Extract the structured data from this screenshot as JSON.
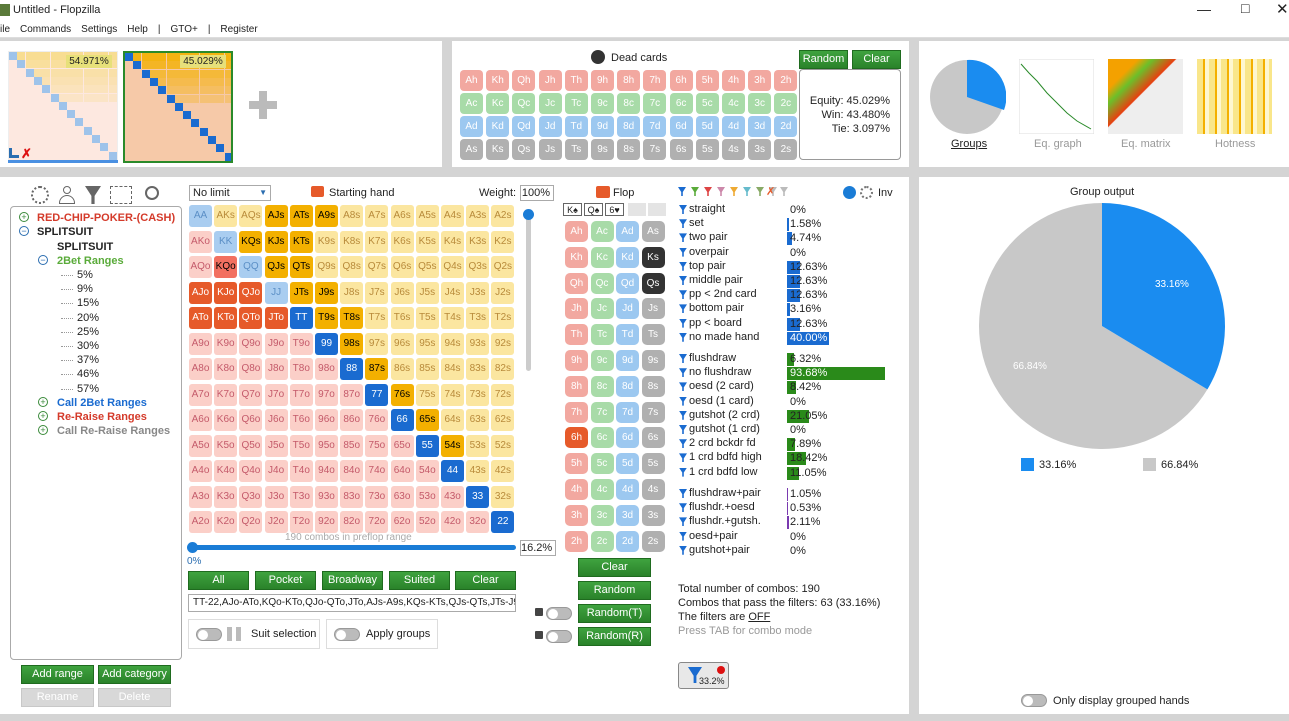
{
  "window": {
    "title": "Untitled - Flopzilla"
  },
  "menu": [
    "ile",
    "Commands",
    "Settings",
    "Help",
    "|",
    "GTO+",
    "|",
    "Register"
  ],
  "ranges_panel": {
    "range1_pct": "54.971%",
    "range2_pct": "45.029%"
  },
  "dead_cards": {
    "title": "Dead cards",
    "random_label": "Random",
    "clear_label": "Clear",
    "rows": [
      [
        "Ah",
        "Kh",
        "Qh",
        "Jh",
        "Th",
        "9h",
        "8h",
        "7h",
        "6h",
        "5h",
        "4h",
        "3h",
        "2h"
      ],
      [
        "Ac",
        "Kc",
        "Qc",
        "Jc",
        "Tc",
        "9c",
        "8c",
        "7c",
        "6c",
        "5c",
        "4c",
        "3c",
        "2c"
      ],
      [
        "Ad",
        "Kd",
        "Qd",
        "Jd",
        "Td",
        "9d",
        "8d",
        "7d",
        "6d",
        "5d",
        "4d",
        "3d",
        "2d"
      ],
      [
        "As",
        "Ks",
        "Qs",
        "Js",
        "Ts",
        "9s",
        "8s",
        "7s",
        "6s",
        "5s",
        "4s",
        "3s",
        "2s"
      ]
    ],
    "equity": "Equity: 45.029%",
    "win": "Win: 43.480%",
    "tie": "Tie: 3.097%"
  },
  "views": {
    "groups": "Groups",
    "eq_graph": "Eq. graph",
    "eq_matrix": "Eq. matrix",
    "hotness": "Hotness"
  },
  "tree": {
    "root1": "RED-CHIP-POKER-(CASH)",
    "root2": "SPLITSUIT",
    "child1": "SPLITSUIT",
    "group": "2Bet Ranges",
    "items": [
      "5%",
      "9%",
      "15%",
      "20%",
      "25%",
      "30%",
      "37%",
      "46%",
      "57%"
    ],
    "call2bet": "Call 2Bet Ranges",
    "reraise": "Re-Raise Ranges",
    "callreraise": "Call Re-Raise Ranges"
  },
  "tree_buttons": {
    "add_range": "Add range",
    "add_category": "Add category",
    "rename": "Rename",
    "delete": "Delete"
  },
  "grid": {
    "limit": "No limit",
    "starting_hand": "Starting hand",
    "weight_label": "Weight:",
    "weight_value": "100%",
    "combos_text": "190 combos in preflop range",
    "slider_min": "0%",
    "slider_value": "16.2%",
    "buttons": [
      "All",
      "Pocket",
      "Broadway",
      "Suited",
      "Clear"
    ],
    "range_text": "TT-22,AJo-ATo,KQo-KTo,QJo-QTo,JTo,AJs-A9s,KQs-KTs,QJs-QTs,JTs-J9s,",
    "suit_selection": "Suit selection",
    "apply_groups": "Apply groups"
  },
  "flop": {
    "title": "Flop",
    "board": [
      "K♠",
      "Q♠",
      "6♥"
    ],
    "clear_label": "Clear",
    "random_label": "Random",
    "random_t": "Random(T)",
    "random_r": "Random(R)"
  },
  "stats": {
    "inv": "Inv",
    "group1": [
      {
        "name": "straight",
        "val": "0%",
        "pct": 0
      },
      {
        "name": "set",
        "val": "1.58%",
        "pct": 1.58
      },
      {
        "name": "two pair",
        "val": "4.74%",
        "pct": 4.74
      },
      {
        "name": "overpair",
        "val": "0%",
        "pct": 0
      },
      {
        "name": "top pair",
        "val": "12.63%",
        "pct": 12.63
      },
      {
        "name": "middle pair",
        "val": "12.63%",
        "pct": 12.63
      },
      {
        "name": "pp < 2nd card",
        "val": "12.63%",
        "pct": 12.63
      },
      {
        "name": "bottom pair",
        "val": "3.16%",
        "pct": 3.16
      },
      {
        "name": "pp < board",
        "val": "12.63%",
        "pct": 12.63
      },
      {
        "name": "no made hand",
        "val": "40.00%",
        "pct": 40.0
      }
    ],
    "group2": [
      {
        "name": "flushdraw",
        "val": "6.32%",
        "pct": 6.32
      },
      {
        "name": "no flushdraw",
        "val": "93.68%",
        "pct": 93.68
      },
      {
        "name": "oesd (2 card)",
        "val": "8.42%",
        "pct": 8.42
      },
      {
        "name": "oesd (1 card)",
        "val": "0%",
        "pct": 0
      },
      {
        "name": "gutshot (2 crd)",
        "val": "21.05%",
        "pct": 21.05
      },
      {
        "name": "gutshot (1 crd)",
        "val": "0%",
        "pct": 0
      },
      {
        "name": "2 crd bckdr fd",
        "val": "7.89%",
        "pct": 7.89
      },
      {
        "name": "1 crd bdfd high",
        "val": "18.42%",
        "pct": 18.42
      },
      {
        "name": "1 crd bdfd low",
        "val": "11.05%",
        "pct": 11.05
      }
    ],
    "group3": [
      {
        "name": "flushdraw+pair",
        "val": "1.05%",
        "pct": 1.05
      },
      {
        "name": "flushdr.+oesd",
        "val": "0.53%",
        "pct": 0.53
      },
      {
        "name": "flushdr.+gutsh.",
        "val": "2.11%",
        "pct": 2.11
      },
      {
        "name": "oesd+pair",
        "val": "0%",
        "pct": 0
      },
      {
        "name": "gutshot+pair",
        "val": "0%",
        "pct": 0
      }
    ],
    "total": "Total number of combos: 190",
    "pass": "Combos that pass the filters: 63 (33.16%)",
    "filters_prefix": "The filters are ",
    "filters_state": "OFF",
    "tab_hint": "Press TAB for combo mode",
    "filter_badge": "33.2%"
  },
  "group_output": {
    "title": "Group output",
    "slice1": "33.16%",
    "slice2": "66.84%",
    "legend1": "33.16%",
    "legend2": "66.84%",
    "only_grouped": "Only display grouped hands",
    "blue": "#1a8cf0",
    "grey": "#c8c8c8"
  },
  "hand_matrix": [
    [
      "AA",
      "AKs",
      "AQs",
      "AJs",
      "ATs",
      "A9s",
      "A8s",
      "A7s",
      "A6s",
      "A5s",
      "A4s",
      "A3s",
      "A2s"
    ],
    [
      "AKo",
      "KK",
      "KQs",
      "KJs",
      "KTs",
      "K9s",
      "K8s",
      "K7s",
      "K6s",
      "K5s",
      "K4s",
      "K3s",
      "K2s"
    ],
    [
      "AQo",
      "KQo",
      "QQ",
      "QJs",
      "QTs",
      "Q9s",
      "Q8s",
      "Q7s",
      "Q6s",
      "Q5s",
      "Q4s",
      "Q3s",
      "Q2s"
    ],
    [
      "AJo",
      "KJo",
      "QJo",
      "JJ",
      "JTs",
      "J9s",
      "J8s",
      "J7s",
      "J6s",
      "J5s",
      "J4s",
      "J3s",
      "J2s"
    ],
    [
      "ATo",
      "KTo",
      "QTo",
      "JTo",
      "TT",
      "T9s",
      "T8s",
      "T7s",
      "T6s",
      "T5s",
      "T4s",
      "T3s",
      "T2s"
    ],
    [
      "A9o",
      "K9o",
      "Q9o",
      "J9o",
      "T9o",
      "99",
      "98s",
      "97s",
      "96s",
      "95s",
      "94s",
      "93s",
      "92s"
    ],
    [
      "A8o",
      "K8o",
      "Q8o",
      "J8o",
      "T8o",
      "98o",
      "88",
      "87s",
      "86s",
      "85s",
      "84s",
      "83s",
      "82s"
    ],
    [
      "A7o",
      "K7o",
      "Q7o",
      "J7o",
      "T7o",
      "97o",
      "87o",
      "77",
      "76s",
      "75s",
      "74s",
      "73s",
      "72s"
    ],
    [
      "A6o",
      "K6o",
      "Q6o",
      "J6o",
      "T6o",
      "96o",
      "86o",
      "76o",
      "66",
      "65s",
      "64s",
      "63s",
      "62s"
    ],
    [
      "A5o",
      "K5o",
      "Q5o",
      "J5o",
      "T5o",
      "95o",
      "85o",
      "75o",
      "65o",
      "55",
      "54s",
      "53s",
      "52s"
    ],
    [
      "A4o",
      "K4o",
      "Q4o",
      "J4o",
      "T4o",
      "94o",
      "84o",
      "74o",
      "64o",
      "54o",
      "44",
      "43s",
      "42s"
    ],
    [
      "A3o",
      "K3o",
      "Q3o",
      "J3o",
      "T3o",
      "93o",
      "83o",
      "73o",
      "63o",
      "53o",
      "43o",
      "33",
      "32s"
    ],
    [
      "A2o",
      "K2o",
      "Q2o",
      "J2o",
      "T2o",
      "92o",
      "82o",
      "72o",
      "62o",
      "52o",
      "42o",
      "32o",
      "22"
    ]
  ]
}
